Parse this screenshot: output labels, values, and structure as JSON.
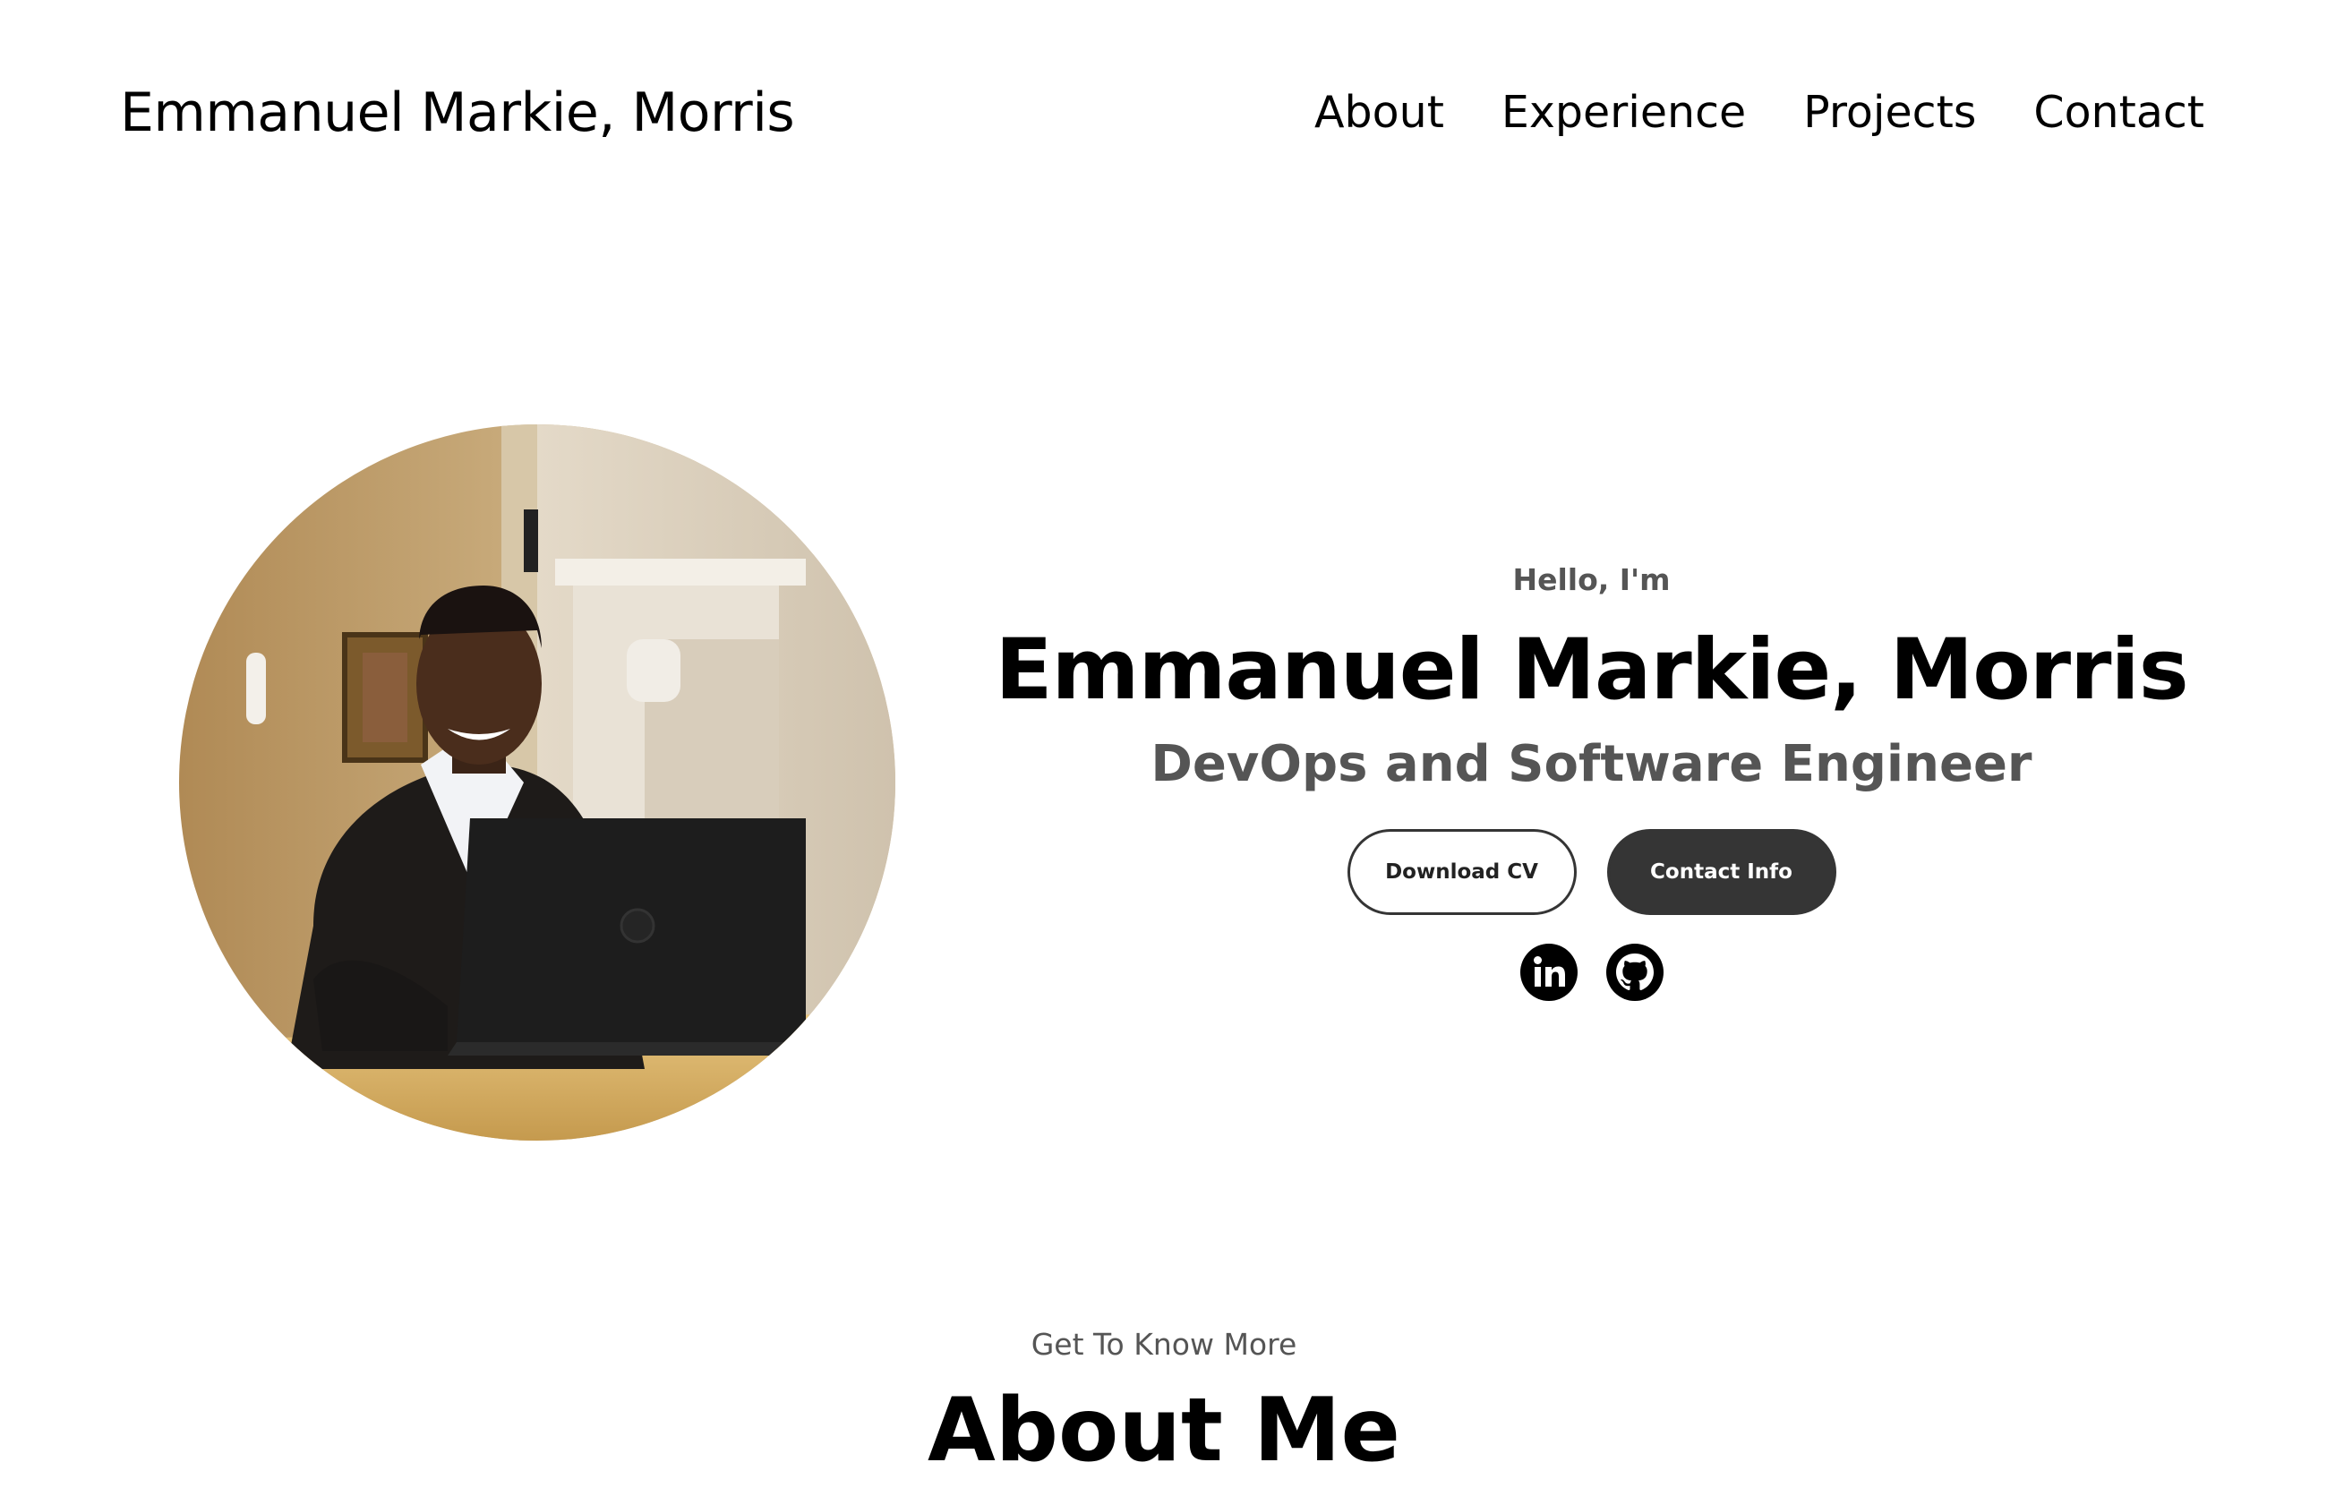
{
  "header": {
    "logo": "Emmanuel Markie, Morris",
    "nav": [
      "About",
      "Experience",
      "Projects",
      "Contact"
    ]
  },
  "hero": {
    "greeting": "Hello, I'm",
    "name": "Emmanuel Markie, Morris",
    "role": "DevOps and Software Engineer",
    "buttons": {
      "download": "Download CV",
      "contact": "Contact Info"
    },
    "socials": [
      "linkedin-icon",
      "github-icon"
    ],
    "colors": {
      "primary_text": "#000000",
      "secondary_text": "#555555",
      "button_dark": "#353535"
    }
  },
  "about": {
    "subtitle": "Get To Know More",
    "title": "About Me"
  }
}
